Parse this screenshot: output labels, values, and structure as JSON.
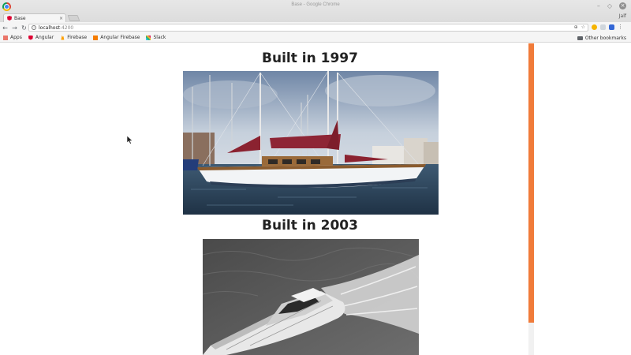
{
  "window": {
    "title": "Base - Google Chrome",
    "profile": "Jalf",
    "controls": {
      "minimize": "–",
      "maximize": "◇",
      "close": "×"
    }
  },
  "tab": {
    "title": "Base",
    "close": "×"
  },
  "toolbar": {
    "back": "←",
    "forward": "→",
    "reload": "↻",
    "url_host": "localhost",
    "url_port": ":4200",
    "zoom_icon": "⊕",
    "star_icon": "☆",
    "menu": "⋮"
  },
  "bookmarks": {
    "items": [
      "Apps",
      "Angular",
      "Firebase",
      "Angular Firebase",
      "Slack"
    ],
    "other": "Other bookmarks"
  },
  "main": {
    "boats": [
      {
        "heading": "Built in 1997",
        "image": "sailboat-photo"
      },
      {
        "heading": "Built in 2003",
        "image": "motorboat-photo"
      }
    ]
  },
  "colors": {
    "scroll_thumb": "#f07b3a",
    "scroll_track": "#f1f1f1"
  }
}
